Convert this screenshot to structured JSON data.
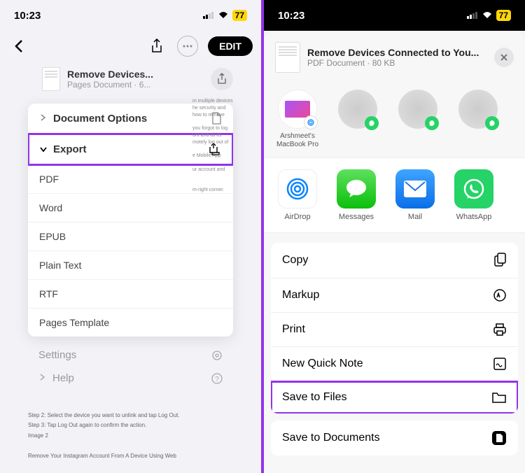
{
  "status": {
    "time": "10:23",
    "battery": "77"
  },
  "left": {
    "nav": {
      "edit": "EDIT"
    },
    "doc": {
      "title": "Remove Devices...",
      "meta": "Pages Document · 6..."
    },
    "bg_text": [
      "m multiple devices",
      "he security and",
      "how to remove",
      "you forgot to log",
      "unt and all its",
      "motely log out of",
      "e Mobile App",
      "ur account and",
      "m-right corner."
    ],
    "menu": {
      "doc_options": "Document Options",
      "export": "Export",
      "items": [
        "PDF",
        "Word",
        "EPUB",
        "Plain Text",
        "RTF",
        "Pages Template"
      ]
    },
    "below": {
      "settings": "Settings",
      "help": "Help"
    },
    "footer": {
      "step2": "Step 2: Select the device you want to unlink and tap Log Out.",
      "step3": "Step 3: Tap Log Out again to confirm the action.",
      "image2": "Image 2",
      "heading": "Remove Your Instagram Account From A Device Using Web"
    }
  },
  "right": {
    "share": {
      "title": "Remove Devices Connected to You...",
      "meta": "PDF Document · 80 KB"
    },
    "contacts": [
      {
        "name": "Arshmeet's MacBook Pro",
        "type": "laptop"
      },
      {
        "name": "",
        "type": "whatsapp"
      },
      {
        "name": "",
        "type": "whatsapp"
      },
      {
        "name": "",
        "type": "whatsapp"
      }
    ],
    "apps": [
      {
        "name": "AirDrop"
      },
      {
        "name": "Messages"
      },
      {
        "name": "Mail"
      },
      {
        "name": "WhatsApp"
      }
    ],
    "actions": [
      "Copy",
      "Markup",
      "Print",
      "New Quick Note",
      "Save to Files"
    ],
    "actions2": [
      "Save to Documents"
    ]
  }
}
